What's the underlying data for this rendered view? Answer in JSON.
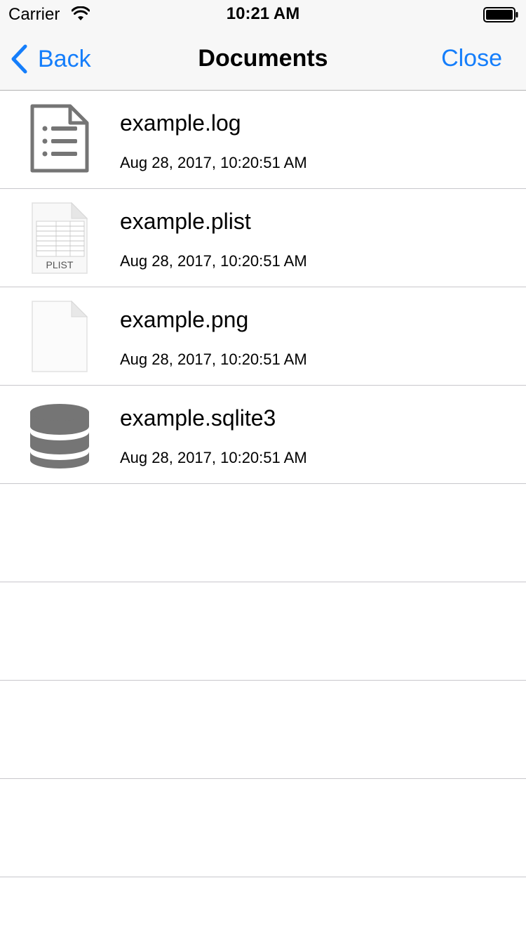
{
  "status_bar": {
    "carrier": "Carrier",
    "time": "10:21 AM"
  },
  "nav": {
    "back_label": "Back",
    "title": "Documents",
    "close_label": "Close"
  },
  "files": [
    {
      "name": "example.log",
      "date": "Aug 28, 2017, 10:20:51 AM",
      "icon": "log-file-icon"
    },
    {
      "name": "example.plist",
      "date": "Aug 28, 2017, 10:20:51 AM",
      "icon": "plist-file-icon",
      "icon_label": "PLIST"
    },
    {
      "name": "example.png",
      "date": "Aug 28, 2017, 10:20:51 AM",
      "icon": "blank-file-icon"
    },
    {
      "name": "example.sqlite3",
      "date": "Aug 28, 2017, 10:20:51 AM",
      "icon": "database-icon"
    }
  ],
  "colors": {
    "accent": "#157efb",
    "separator": "#c8c7cc",
    "bar_background": "#f7f7f7",
    "icon_gray": "#757575"
  }
}
